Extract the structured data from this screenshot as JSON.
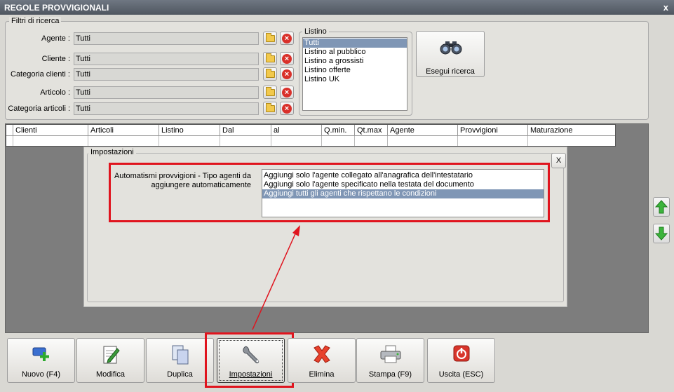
{
  "window": {
    "title": "REGOLE PROVVIGIONALI",
    "close": "x"
  },
  "filters": {
    "group_title": "Filtri di ricerca",
    "agente": {
      "label": "Agente :",
      "value": "Tutti"
    },
    "cliente": {
      "label": "Cliente :",
      "value": "Tutti"
    },
    "categoria_clienti": {
      "label": "Categoria clienti :",
      "value": "Tutti"
    },
    "articolo": {
      "label": "Articolo :",
      "value": "Tutti"
    },
    "categoria_articoli": {
      "label": "Categoria articoli :",
      "value": "Tutti"
    }
  },
  "listino": {
    "title": "Listino",
    "items": [
      "Tutti",
      "Listino al pubblico",
      "Listino a grossisti",
      "Listino offerte",
      "Listino UK"
    ],
    "selected": "Tutti"
  },
  "search_button": {
    "label": "Esegui ricerca",
    "icon": "binoculars-icon"
  },
  "grid": {
    "columns": [
      "Clienti",
      "Articoli",
      "Listino",
      "Dal",
      "al",
      "Q.min.",
      "Qt.max",
      "Agente",
      "Provvigioni",
      "Maturazione"
    ]
  },
  "settings_panel": {
    "title": "Impostazioni",
    "close_label": "X",
    "field_label_line1": "Automatismi provvigioni - Tipo agenti da",
    "field_label_line2": "aggiungere automaticamente",
    "options": [
      "Aggiungi solo l'agente collegato all'anagrafica dell'intestatario",
      "Aggiungi solo l'agente specificato nella testata del documento",
      "Aggiungi tutti gli agenti che rispettano le condizioni"
    ],
    "selected": "Aggiungi tutti gli agenti che rispettano le condizioni"
  },
  "toolbar": {
    "nuovo": "Nuovo (F4)",
    "modifica": "Modifica",
    "duplica": "Duplica",
    "impostazioni": "Impostazioni",
    "elimina": "Elimina",
    "stampa": "Stampa (F9)",
    "uscita": "Uscita (ESC)"
  },
  "colors": {
    "highlight": "#e0141e",
    "selection": "#7f96b5",
    "title_bar": "#5a616b"
  }
}
